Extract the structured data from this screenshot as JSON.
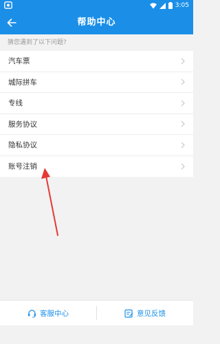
{
  "status_bar": {
    "time": "3:05"
  },
  "app_bar": {
    "title": "帮助中心",
    "back_icon": "arrow-left-icon"
  },
  "prompt": "猜您遇到了以下问题?",
  "items": [
    {
      "label": "汽车票"
    },
    {
      "label": "城际拼车"
    },
    {
      "label": "专线"
    },
    {
      "label": "服务协议"
    },
    {
      "label": "隐私协议"
    },
    {
      "label": "账号注销"
    }
  ],
  "bottom_bar": {
    "service_label": "客服中心",
    "feedback_label": "意见反馈"
  },
  "colors": {
    "primary": "#1b8fe8",
    "annotation": "#e53935"
  }
}
